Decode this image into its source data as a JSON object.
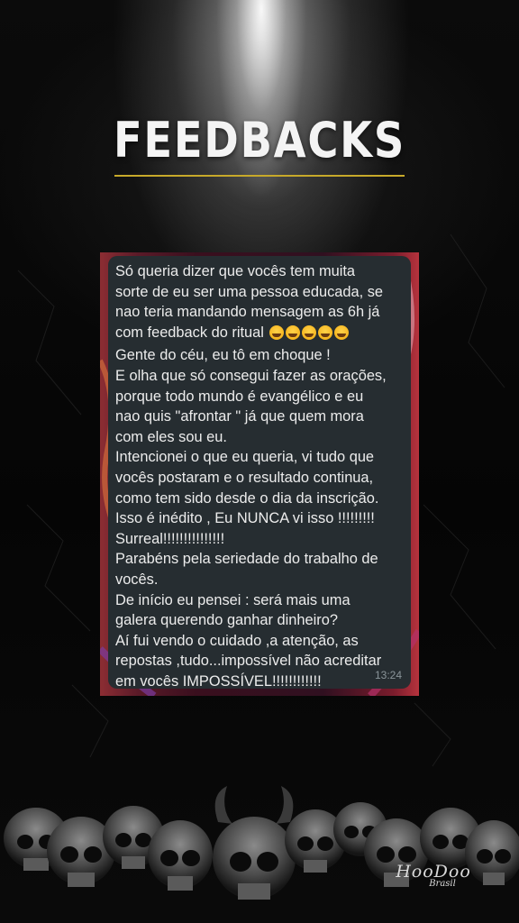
{
  "page": {
    "title": "FEEDBACKS",
    "accent_color": "#c7a92a"
  },
  "chat_message": {
    "bubble_color": "#262d31",
    "text_color": "#ececec",
    "lines": [
      "Só queria dizer que  vocês tem muita",
      "sorte de eu ser uma pessoa educada, se",
      "nao teria  mandando mensagem as 6h já",
      "com feedback do ritual",
      "Gente do céu, eu tô em choque !",
      "E olha que só consegui fazer as orações,",
      "porque todo mundo é evangélico e eu",
      "nao quis \"afrontar \" já que quem mora",
      "com eles sou eu.",
      "Intencionei o que eu queria, vi tudo que",
      "vocês postaram e o resultado continua,",
      "como tem sido desde  o dia da inscrição.",
      "Isso é inédito , Eu NUNCA vi isso !!!!!!!!!",
      "Surreal!!!!!!!!!!!!!!!",
      "Parabéns pela seriedade do trabalho de",
      "vocês.",
      "De início eu pensei : será mais uma",
      "galera querendo ganhar dinheiro?",
      "Aí fui vendo o cuidado ,a atenção, as",
      "repostas ,tudo...impossível não acreditar",
      "em vocês IMPOSSÍVEL!!!!!!!!!!!!"
    ],
    "emoji": "laughing-tears-emoji",
    "emoji_count": 5,
    "time": "13:24"
  },
  "brand": {
    "name": "HooDoo",
    "subtitle": "Brasil"
  },
  "decor": {
    "skull_pile": "skulls-illustration",
    "spotlight": "spotlight-beam"
  }
}
